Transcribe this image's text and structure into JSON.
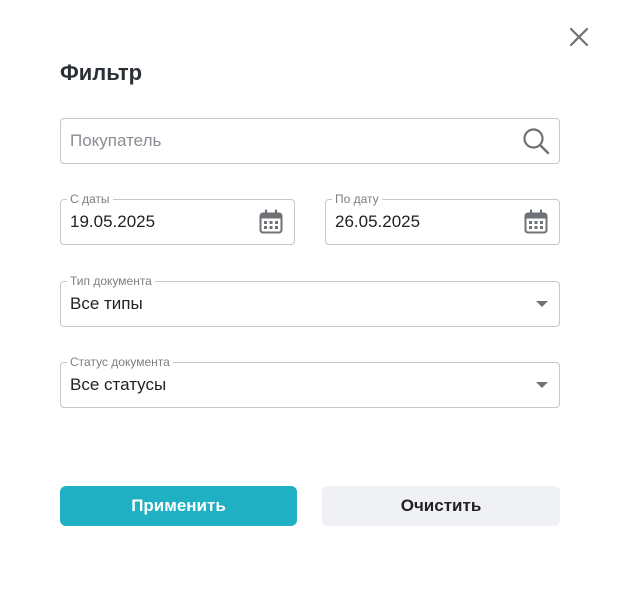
{
  "dialog": {
    "title": "Фильтр",
    "close_icon": "close-icon"
  },
  "search": {
    "placeholder": "Покупатель",
    "value": "",
    "icon": "search-icon"
  },
  "date_from": {
    "label": "С даты",
    "value": "19.05.2025",
    "icon": "calendar-icon"
  },
  "date_to": {
    "label": "По дату",
    "value": "26.05.2025",
    "icon": "calendar-icon"
  },
  "doc_type": {
    "label": "Тип документа",
    "value": "Все типы",
    "icon": "caret-down-icon"
  },
  "doc_status": {
    "label": "Статус документа",
    "value": "Все статусы",
    "icon": "caret-down-icon"
  },
  "actions": {
    "apply_label": "Применить",
    "clear_label": "Очистить"
  },
  "colors": {
    "accent": "#1fb0c4",
    "button_secondary_bg": "#f0f1f5",
    "title_text": "#2b2f36",
    "border": "#c4c7cc",
    "icon_gray": "#6e7175"
  }
}
